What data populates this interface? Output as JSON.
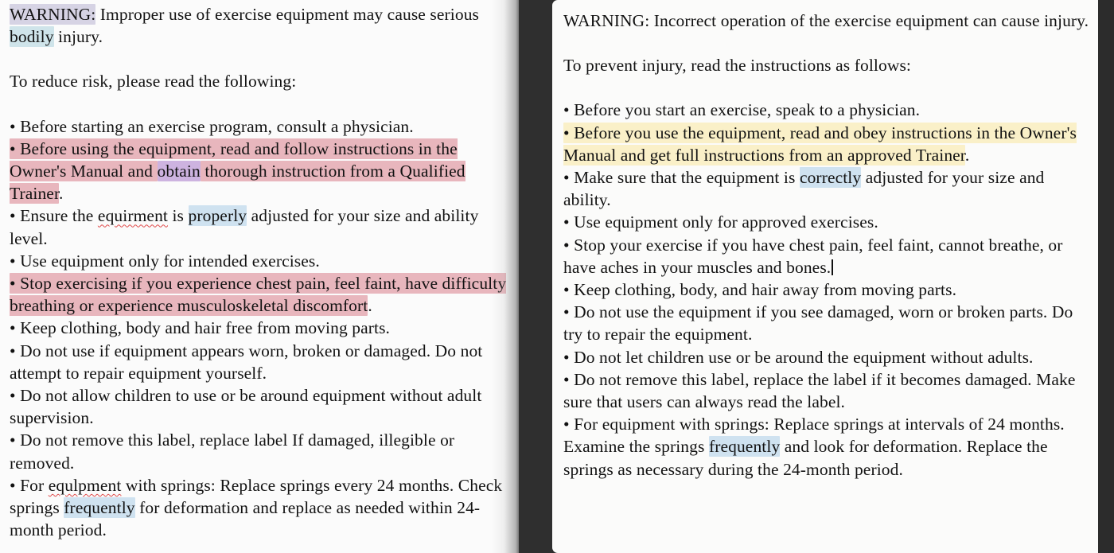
{
  "colors": {
    "highlight_pink": "#e8b6bd",
    "highlight_purple": "#cdb3e0",
    "highlight_blue": "#cfe2f0",
    "highlight_cyan": "#cfe4ea",
    "highlight_lavender": "#d6d3e4",
    "highlight_yellow": "#faf0c8",
    "page_background": "#fbfbfb",
    "gutter": "#2c2c2c",
    "text": "#121212",
    "spellcheck_underline": "#e04a4a"
  },
  "left_document": {
    "heading_label": "WARNING:",
    "heading_rest_a": " Improper use of exercise equipment may cause serious ",
    "heading_rest_b": "bodily",
    "heading_rest_c": " injury.",
    "intro": "To reduce risk, please read the following:",
    "b1": "• Before starting an exercise program, consult a physician.",
    "b2_a": "• Before using the equipment, read and follow instructions in the Owner's Manual and ",
    "b2_b": "obtain",
    "b2_c": " thorough instruction from a Qualified Trainer",
    "b2_d": ".",
    "b3_a": "• Ensure the ",
    "b3_b": "equirment",
    "b3_c": " is ",
    "b3_d": "properly",
    "b3_e": " adjusted for your size and ability level.",
    "b4": "• Use equipment only for intended exercises.",
    "b5_a": "• Stop exercising if you experience chest pain, feel faint, have difficulty breathing or experience musculoskeletal discomfort",
    "b5_b": ".",
    "b6": "• Keep clothing, body and hair free from moving parts.",
    "b7": "• Do not use if equipment appears worn, broken or damaged. Do not attempt to repair equipment yourself.",
    "b8": "• Do not allow children to use or be around equipment without adult supervision.",
    "b9": "• Do not remove this label, replace label If damaged, illegible or removed.",
    "b10_a": "• For ",
    "b10_b": "equlpment",
    "b10_c": " with springs: Replace springs every 24 months. Check springs ",
    "b10_d": "frequently",
    "b10_e": " for deformation and replace as needed within 24-month period."
  },
  "right_document": {
    "heading": "WARNING: Incorrect operation of the exercise equipment can cause injury.",
    "intro": "To prevent injury, read the instructions as follows:",
    "b1": "• Before you start an exercise, speak to a physician.",
    "b2_a": "• Before you use the equipment, read and obey instructions in the Owner's Manual and get full instructions from an approved Trainer",
    "b2_b": ".",
    "b3_a": "• Make sure that the equipment is ",
    "b3_b": "correctly",
    "b3_c": " adjusted for your size and ability.",
    "b4": "• Use equipment only for approved exercises.",
    "b5": "• Stop your exercise if you have chest pain, feel faint, cannot breathe, or have aches in your muscles and bones.",
    "b6": "• Keep clothing, body, and hair away from moving parts.",
    "b7": "• Do not use the equipment if you see damaged, worn or broken parts. Do try to repair the equipment.",
    "b8": "• Do not let children use or be around the equipment without adults.",
    "b9": "• Do not remove this label, replace the label if it becomes damaged. Make sure that users can always read the label.",
    "b10_a": "• For equipment with springs: Replace springs at intervals of 24 months. Examine the springs ",
    "b10_b": "frequently",
    "b10_c": " and look for deformation. Replace the springs as necessary during the 24-month period."
  }
}
